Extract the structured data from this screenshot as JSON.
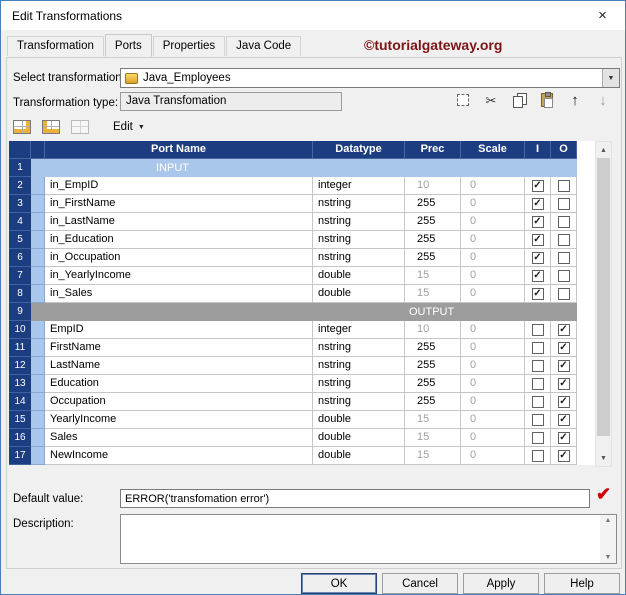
{
  "window": {
    "title": "Edit Transformations",
    "close_glyph": "×"
  },
  "watermark": "©tutorialgateway.org",
  "tabs": [
    "Transformation",
    "Ports",
    "Properties",
    "Java Code"
  ],
  "active_tab": "Ports",
  "form": {
    "select_transformation": {
      "label": "Select transformation:",
      "value": "Java_Employees"
    },
    "transformation_type": {
      "label": "Transformation type:",
      "value": "Java Transfomation"
    }
  },
  "toolbar": {
    "edit_menu_label": "Edit"
  },
  "icons": {
    "cut": "✂",
    "up_arrow": "↑",
    "down_arrow": "↓",
    "dropdown_arrow": "▼",
    "menu_arrow": "▼",
    "scroll_up": "▲",
    "scroll_down": "▼",
    "checkmark": "✓",
    "valid_check": "✔"
  },
  "ports_table": {
    "headers": {
      "port_name": "Port Name",
      "datatype": "Datatype",
      "prec": "Prec",
      "scale": "Scale",
      "i": "I",
      "o": "O"
    },
    "rows": [
      {
        "num": "1",
        "section": "INPUT"
      },
      {
        "num": "2",
        "name": "in_EmpID",
        "datatype": "integer",
        "prec": "10",
        "scale": "0",
        "i": true,
        "o": false,
        "prec_disabled": true
      },
      {
        "num": "3",
        "name": "in_FirstName",
        "datatype": "nstring",
        "prec": "255",
        "scale": "0",
        "i": true,
        "o": false,
        "prec_disabled": false
      },
      {
        "num": "4",
        "name": "in_LastName",
        "datatype": "nstring",
        "prec": "255",
        "scale": "0",
        "i": true,
        "o": false,
        "prec_disabled": false
      },
      {
        "num": "5",
        "name": "in_Education",
        "datatype": "nstring",
        "prec": "255",
        "scale": "0",
        "i": true,
        "o": false,
        "prec_disabled": false
      },
      {
        "num": "6",
        "name": "in_Occupation",
        "datatype": "nstring",
        "prec": "255",
        "scale": "0",
        "i": true,
        "o": false,
        "prec_disabled": false
      },
      {
        "num": "7",
        "name": "in_YearlyIncome",
        "datatype": "double",
        "prec": "15",
        "scale": "0",
        "i": true,
        "o": false,
        "prec_disabled": true
      },
      {
        "num": "8",
        "name": "in_Sales",
        "datatype": "double",
        "prec": "15",
        "scale": "0",
        "i": true,
        "o": false,
        "prec_disabled": true
      },
      {
        "num": "9",
        "section": "OUTPUT"
      },
      {
        "num": "10",
        "name": "EmpID",
        "datatype": "integer",
        "prec": "10",
        "scale": "0",
        "i": false,
        "o": true,
        "prec_disabled": true
      },
      {
        "num": "11",
        "name": "FirstName",
        "datatype": "nstring",
        "prec": "255",
        "scale": "0",
        "i": false,
        "o": true,
        "prec_disabled": false
      },
      {
        "num": "12",
        "name": "LastName",
        "datatype": "nstring",
        "prec": "255",
        "scale": "0",
        "i": false,
        "o": true,
        "prec_disabled": false
      },
      {
        "num": "13",
        "name": "Education",
        "datatype": "nstring",
        "prec": "255",
        "scale": "0",
        "i": false,
        "o": true,
        "prec_disabled": false
      },
      {
        "num": "14",
        "name": "Occupation",
        "datatype": "nstring",
        "prec": "255",
        "scale": "0",
        "i": false,
        "o": true,
        "prec_disabled": false
      },
      {
        "num": "15",
        "name": "YearlyIncome",
        "datatype": "double",
        "prec": "15",
        "scale": "0",
        "i": false,
        "o": true,
        "prec_disabled": true
      },
      {
        "num": "16",
        "name": "Sales",
        "datatype": "double",
        "prec": "15",
        "scale": "0",
        "i": false,
        "o": true,
        "prec_disabled": true
      },
      {
        "num": "17",
        "name": "NewIncome",
        "datatype": "double",
        "prec": "15",
        "scale": "0",
        "i": false,
        "o": true,
        "prec_disabled": true
      }
    ]
  },
  "default_value": {
    "label": "Default value:",
    "value": "ERROR('transfomation error')"
  },
  "description": {
    "label": "Description:",
    "value": ""
  },
  "buttons": {
    "ok": "OK",
    "cancel": "Cancel",
    "apply": "Apply",
    "help": "Help"
  },
  "colors": {
    "header_navy": "#1c3e80",
    "input_section_blue": "#a9c7ea",
    "output_section_gray": "#9d9d9d",
    "watermark_red": "#7d1416",
    "valid_check_red": "#cc0000"
  }
}
